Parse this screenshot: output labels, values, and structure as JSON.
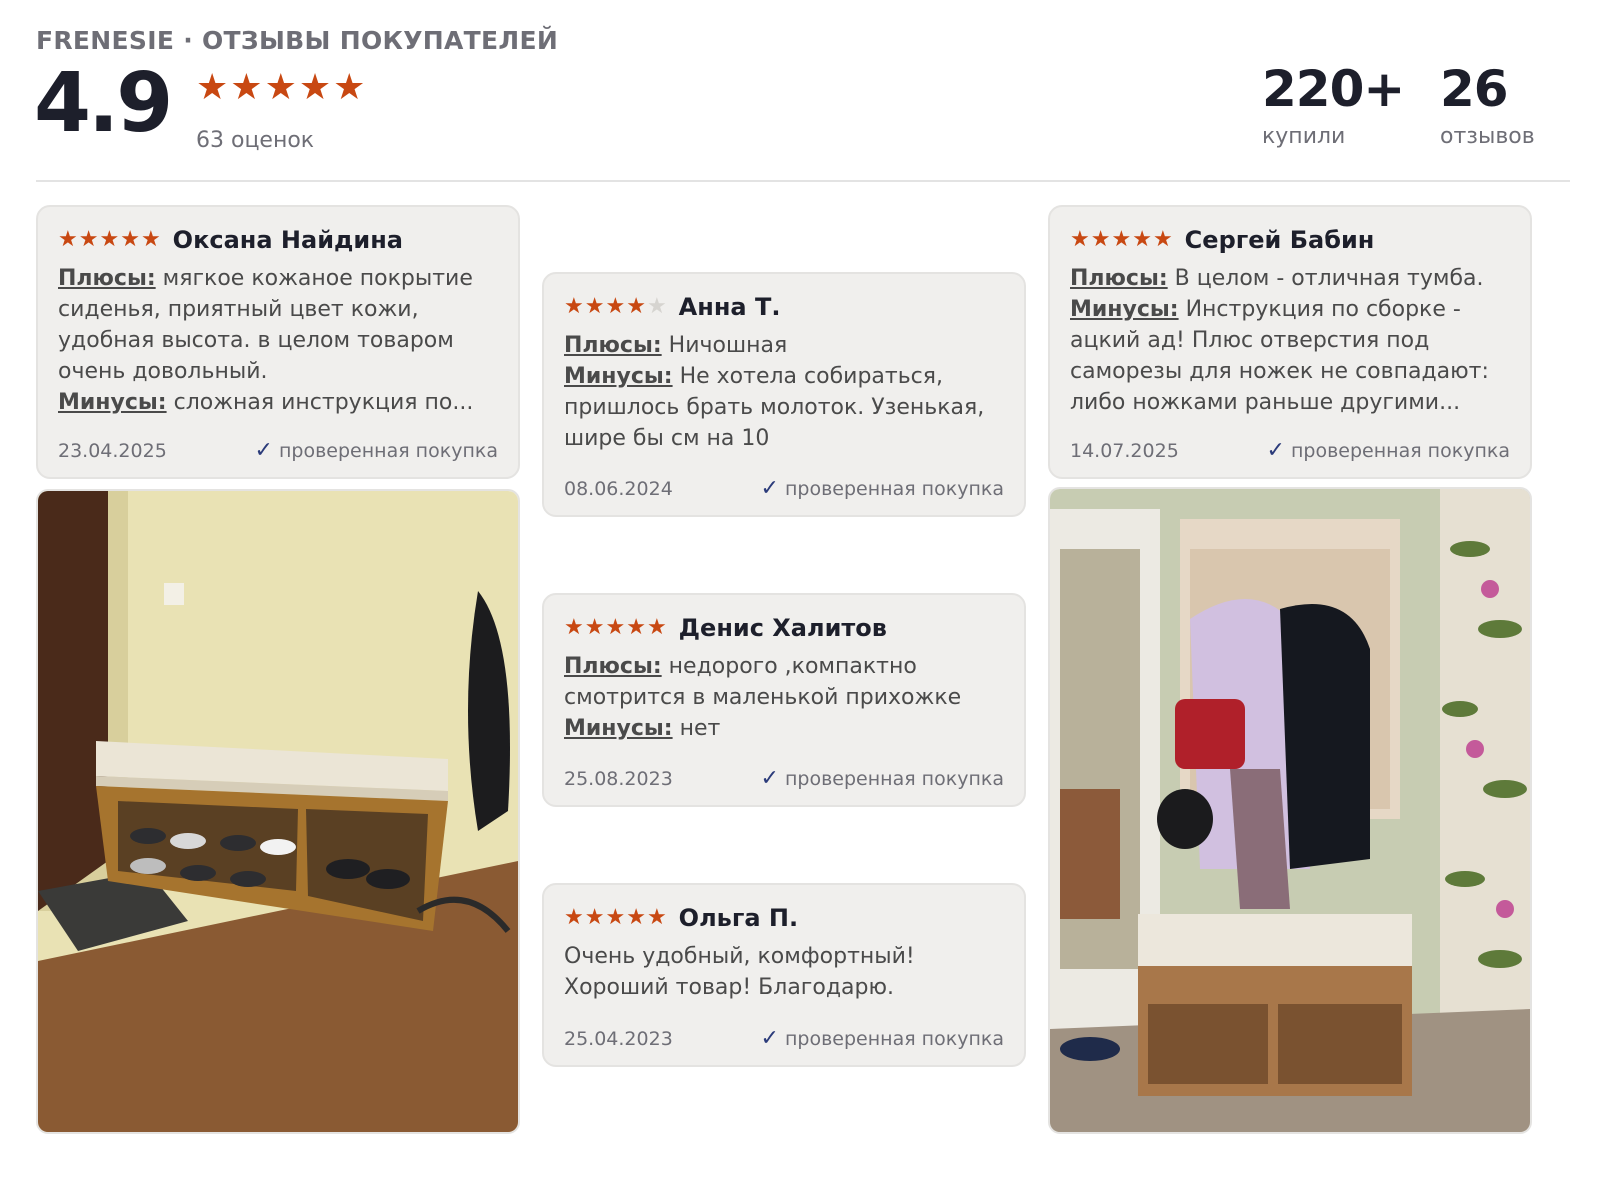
{
  "header": {
    "brand": "FRENESIE · ОТЗЫВЫ ПОКУПАТЕЛЕЙ",
    "rating": "4.9",
    "stars": 5,
    "ratings_count": "63 оценок",
    "bought_value": "220+",
    "bought_label": "купили",
    "reviews_value": "26",
    "reviews_label": "отзывов"
  },
  "labels": {
    "pros": "Плюсы:",
    "cons": "Минусы:"
  },
  "reviews": [
    {
      "stars": 5,
      "name": "Оксана Найдина",
      "pros": "мягкое кожаное покрытие сиденья, приятный цвет кожи, удобная высота. в целом товаром очень довольный.",
      "cons": "сложная инструкция по...",
      "date": "23.04.2025",
      "verified": "проверенная покупка"
    },
    {
      "stars": 4,
      "name": "Анна Т.",
      "pros": "Ничошная",
      "cons": "Не хотела собираться, пришлось брать молоток. Узенькая, шире бы см на 10",
      "date": "08.06.2024",
      "verified": "проверенная покупка"
    },
    {
      "stars": 5,
      "name": "Сергей Бабин",
      "pros": "В целом - отличная тумба.",
      "cons": "Инструкция по сборке - ацкий ад! Плюс отверстия под саморезы для ножек не совпадают: либо ножками раньше другими...",
      "date": "14.07.2025",
      "verified": "проверенная покупка"
    },
    {
      "stars": 5,
      "name": "Денис Халитов",
      "pros": "недорого ,компактно смотрится в маленькой прихожке",
      "cons": "нет",
      "date": "25.08.2023",
      "verified": "проверенная покупка"
    },
    {
      "stars": 5,
      "name": "Ольга П.",
      "text": "Очень удобный, комфортный! Хороший товар! Благодарю.",
      "date": "25.04.2023",
      "verified": "проверенная покупка"
    }
  ],
  "colors": {
    "star": "#c84812",
    "star_off": "#d6d4d0",
    "check": "#2b3b7a",
    "card_bg": "#f0efed"
  }
}
